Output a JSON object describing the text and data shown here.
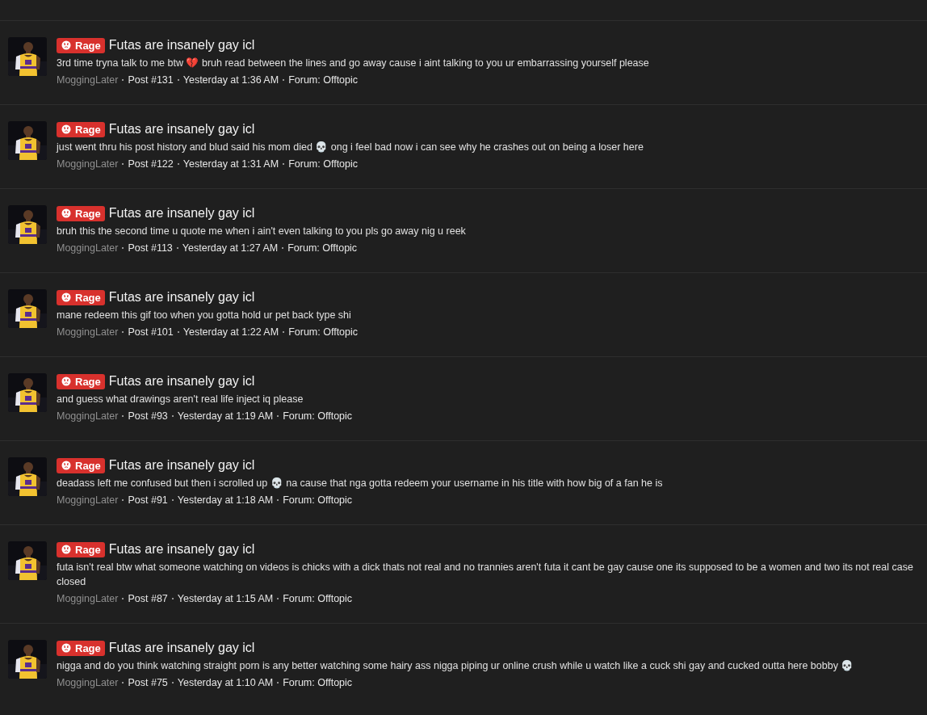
{
  "posts": [
    {
      "label": "Rage",
      "title": "Futas are insanely gay icl",
      "body": "3rd time tryna talk to me btw 💔 bruh read between the lines and go away cause i aint talking to you ur embarrassing yourself please",
      "author": "MoggingLater",
      "post": "Post #131",
      "time": "Yesterday at 1:36 AM",
      "forum": "Forum: Offtopic"
    },
    {
      "label": "Rage",
      "title": "Futas are insanely gay icl",
      "body": "just went thru his post history and blud said his mom died 💀 ong i feel bad now i can see why he crashes out on being a loser here",
      "author": "MoggingLater",
      "post": "Post #122",
      "time": "Yesterday at 1:31 AM",
      "forum": "Forum: Offtopic"
    },
    {
      "label": "Rage",
      "title": "Futas are insanely gay icl",
      "body": "bruh this the second time u quote me when i ain't even talking to you pls go away nig u reek",
      "author": "MoggingLater",
      "post": "Post #113",
      "time": "Yesterday at 1:27 AM",
      "forum": "Forum: Offtopic"
    },
    {
      "label": "Rage",
      "title": "Futas are insanely gay icl",
      "body": "mane redeem this gif too when you gotta hold ur pet back type shi",
      "author": "MoggingLater",
      "post": "Post #101",
      "time": "Yesterday at 1:22 AM",
      "forum": "Forum: Offtopic"
    },
    {
      "label": "Rage",
      "title": "Futas are insanely gay icl",
      "body": "and guess what drawings aren't real life inject iq please",
      "author": "MoggingLater",
      "post": "Post #93",
      "time": "Yesterday at 1:19 AM",
      "forum": "Forum: Offtopic"
    },
    {
      "label": "Rage",
      "title": "Futas are insanely gay icl",
      "body": "deadass left me confused but then i scrolled up 💀 na cause that nga gotta redeem your username in his title with how big of a fan he is",
      "author": "MoggingLater",
      "post": "Post #91",
      "time": "Yesterday at 1:18 AM",
      "forum": "Forum: Offtopic"
    },
    {
      "label": "Rage",
      "title": "Futas are insanely gay icl",
      "body": "futa isn't real btw what someone watching on videos is chicks with a dick thats not real and no trannies aren't futa it cant be gay cause one its supposed to be a women and two its not real case closed",
      "author": "MoggingLater",
      "post": "Post #87",
      "time": "Yesterday at 1:15 AM",
      "forum": "Forum: Offtopic"
    },
    {
      "label": "Rage",
      "title": "Futas are insanely gay icl",
      "body": "nigga and do you think watching straight porn is any better watching some hairy ass nigga piping ur online crush while u watch like a cuck shi gay and cucked outta here bobby 💀",
      "author": "MoggingLater",
      "post": "Post #75",
      "time": "Yesterday at 1:10 AM",
      "forum": "Forum: Offtopic"
    }
  ]
}
